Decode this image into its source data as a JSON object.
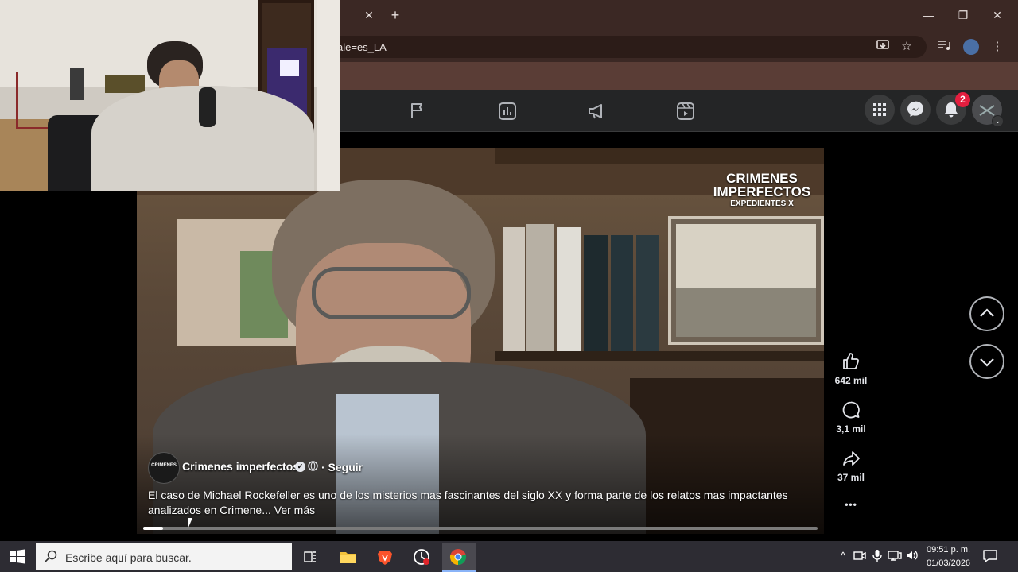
{
  "browser": {
    "tab_close": "✕",
    "new_tab": "+",
    "url_fragment": "ale=es_LA",
    "window_controls": {
      "minimize": "—",
      "restore": "❐",
      "close": "✕"
    }
  },
  "facebook_nav": {
    "notification_count": "2",
    "icons": [
      "flag-icon",
      "insights-icon",
      "megaphone-icon",
      "reels-icon"
    ]
  },
  "video": {
    "watermark_line1": "CRIMENES",
    "watermark_line2": "IMPERFECTOS",
    "watermark_line3": "EXPEDIENTES X",
    "channel_name": "Crimenes imperfectos",
    "follow_label": "· Seguir",
    "caption": "El caso de Michael Rockefeller es uno de los misterios mas fascinantes del siglo XX y forma parte de los relatos mas impactantes analizados en Crimene...",
    "see_more": "Ver más",
    "progress_fraction": 0.03
  },
  "actions": {
    "likes": "642 mil",
    "comments": "3,1 mil",
    "shares": "37 mil",
    "more": "•••"
  },
  "taskbar": {
    "search_placeholder": "Escribe aquí para buscar.",
    "time": "09:51 p. m.",
    "date": "01/03/2026"
  },
  "colors": {
    "chrome_frame": "#3b2824",
    "facebook_nav": "#242526",
    "notification_badge": "#e41e3f",
    "taskbar": "#2d2c33"
  }
}
